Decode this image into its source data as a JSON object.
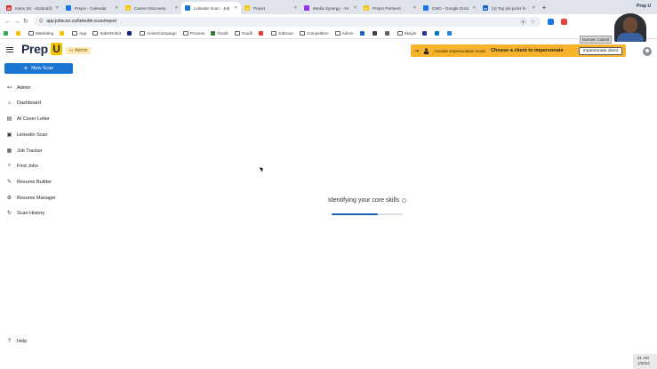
{
  "browser": {
    "tabs": [
      {
        "label": "Inbox (8) - dcabral@",
        "fav_color": "#d93025",
        "fav_glyph": "M",
        "active": false
      },
      {
        "label": "PrepU - Calendar",
        "fav_color": "#1a73e8",
        "fav_glyph": "",
        "active": false
      },
      {
        "label": "Career Discovery",
        "fav_color": "#f6c500",
        "fav_glyph": "U",
        "active": false
      },
      {
        "label": "Linkedin Scan - Job",
        "fav_color": "#1976d2",
        "fav_glyph": "",
        "active": true
      },
      {
        "label": "PrepU",
        "fav_color": "#f6c500",
        "fav_glyph": "U",
        "active": false
      },
      {
        "label": "Media Synergy - Vir",
        "fav_color": "#9334e6",
        "fav_glyph": "",
        "active": false
      },
      {
        "label": "PrepU Partners",
        "fav_color": "#f6c500",
        "fav_glyph": "U",
        "active": false
      },
      {
        "label": "CMO - Google Docs",
        "fav_color": "#1a73e8",
        "fav_glyph": "",
        "active": false
      },
      {
        "label": "(4) Top job picks fo",
        "fav_color": "#0a66c2",
        "fav_glyph": "in",
        "active": false
      }
    ],
    "new_tab_label": "+",
    "url": "app.jobscan.co/linkedin-scan/report",
    "bookmarks": [
      {
        "label": "",
        "kind": "icon",
        "color": "#34a853"
      },
      {
        "label": "",
        "kind": "icon",
        "color": "#fbbc04"
      },
      {
        "label": "Marketing",
        "kind": "folder"
      },
      {
        "label": "",
        "kind": "icon",
        "color": "#f6c500"
      },
      {
        "label": "App",
        "kind": "folder"
      },
      {
        "label": "SalesRobot",
        "kind": "folder"
      },
      {
        "label": "",
        "kind": "icon",
        "color": "#1a237e"
      },
      {
        "label": "ActiveCampaign",
        "kind": "folder"
      },
      {
        "label": "Process",
        "kind": "folder"
      },
      {
        "label": "Yoodli",
        "kind": "icon",
        "color": "#2e7d32"
      },
      {
        "label": "Yoodli",
        "kind": "folder"
      },
      {
        "label": "",
        "kind": "icon",
        "color": "#e53935"
      },
      {
        "label": "Jobscan",
        "kind": "folder"
      },
      {
        "label": "Competition",
        "kind": "folder"
      },
      {
        "label": "Admin",
        "kind": "folder"
      },
      {
        "label": "",
        "kind": "icon",
        "color": "#1565c0"
      },
      {
        "label": "",
        "kind": "icon",
        "color": "#424242"
      },
      {
        "label": "",
        "kind": "icon",
        "color": "#616161"
      },
      {
        "label": "Skayle",
        "kind": "folder"
      },
      {
        "label": "",
        "kind": "icon",
        "color": "#283593"
      },
      {
        "label": "",
        "kind": "icon",
        "color": "#0277bd"
      },
      {
        "label": "",
        "kind": "icon",
        "color": "#1e88e5"
      }
    ]
  },
  "app": {
    "logo_text": "Prep",
    "logo_letter": "U",
    "admin_badge": "Admin",
    "impersonation": {
      "label": "Activate impersonation mode",
      "prompt": "Choose a client to impersonate",
      "button": "Impersonate client"
    },
    "new_scan_label": "New Scan",
    "nav": [
      {
        "label": "Admin",
        "icon": "admin-arrow-icon",
        "glyph": "↤"
      },
      {
        "label": "Dashboard",
        "icon": "home-icon",
        "glyph": "⌂"
      },
      {
        "label": "AI Cover Letter",
        "icon": "document-icon",
        "glyph": "▤"
      },
      {
        "label": "Linkedin Scan",
        "icon": "linkedin-icon",
        "glyph": "▣"
      },
      {
        "label": "Job Tracker",
        "icon": "tracker-icon",
        "glyph": "▦"
      },
      {
        "label": "Find Jobs",
        "icon": "search-icon",
        "glyph": "⌕"
      },
      {
        "label": "Resume Builder",
        "icon": "pencil-icon",
        "glyph": "✎"
      },
      {
        "label": "Resume Manager",
        "icon": "gear-icon",
        "glyph": "⚙"
      },
      {
        "label": "Scan History",
        "icon": "history-icon",
        "glyph": "↻"
      }
    ],
    "help_label": "Help",
    "status_text": "Identifying your core skills",
    "progress": 0.65
  },
  "overlay": {
    "brand": "Prep U",
    "cam_name": "Damian Cabral",
    "clock_time": "51 AM",
    "clock_date": "1/2024"
  }
}
